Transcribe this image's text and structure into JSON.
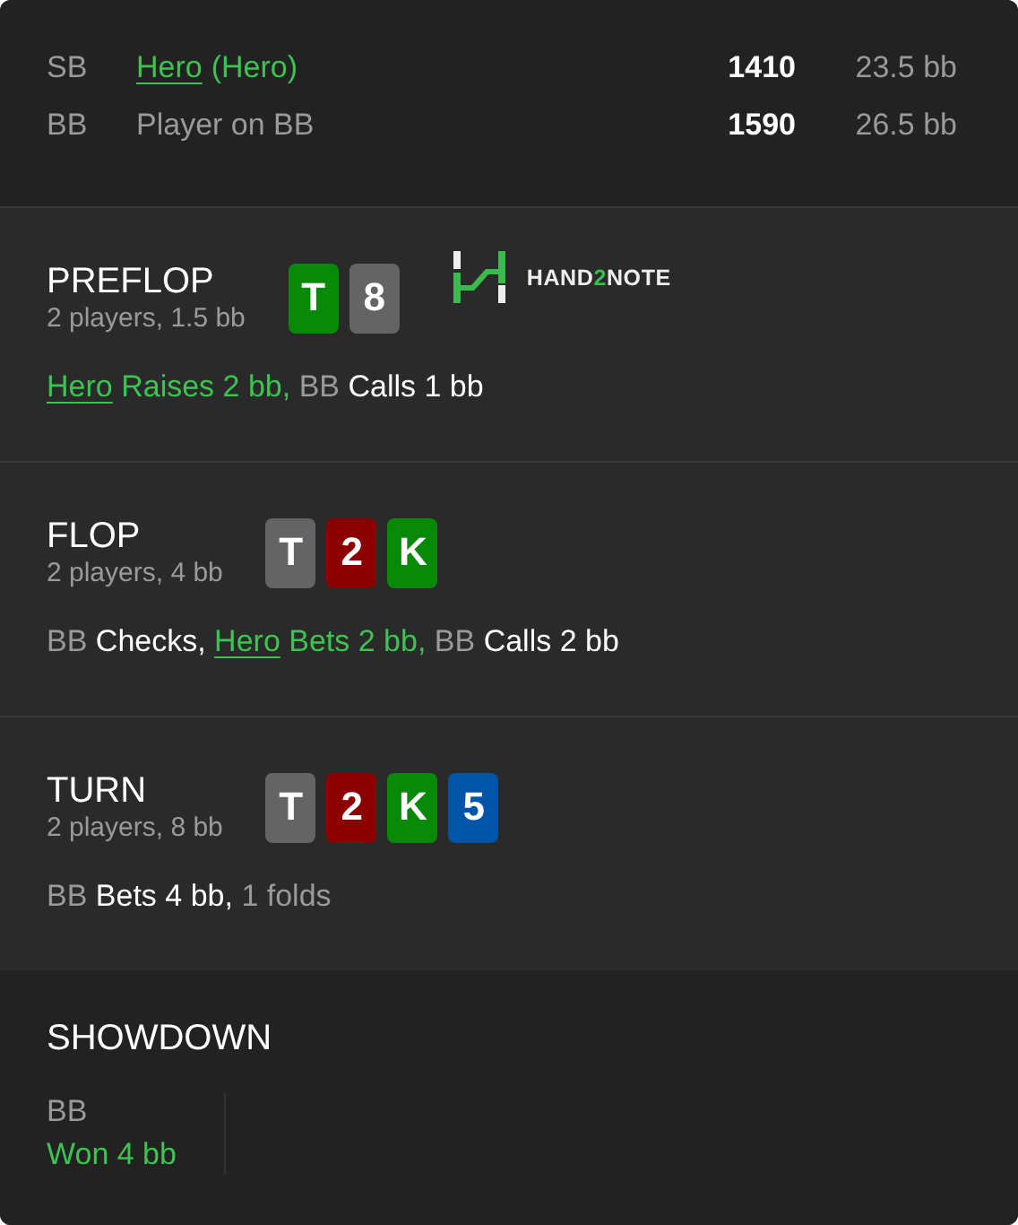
{
  "players": [
    {
      "position": "SB",
      "name": "Hero",
      "is_hero": true,
      "tag": "(Hero)",
      "stack": "1410",
      "stack_bb": "23.5 bb"
    },
    {
      "position": "BB",
      "name": "Player on BB",
      "is_hero": false,
      "stack": "1590",
      "stack_bb": "26.5 bb"
    }
  ],
  "streets": [
    {
      "title": "PREFLOP",
      "summary": "2 players, 1.5 bb",
      "cards": [
        {
          "rank": "T",
          "color": "#088a08"
        },
        {
          "rank": "8",
          "color": "#646464"
        }
      ],
      "logo": {
        "parts": [
          {
            "text": "HAND",
            "accent": false
          },
          {
            "text": "2",
            "accent": true
          },
          {
            "text": "NOTE",
            "accent": false
          }
        ]
      },
      "actions": [
        {
          "kind": "hero_link",
          "text": "Hero"
        },
        {
          "kind": "hero",
          "text": " Raises 2 bb,"
        },
        {
          "kind": "player",
          "text": " BB"
        },
        {
          "kind": "plain",
          "text": " Calls 1 bb"
        }
      ]
    },
    {
      "title": "FLOP",
      "summary": "2 players, 4 bb",
      "cards": [
        {
          "rank": "T",
          "color": "#646464"
        },
        {
          "rank": "2",
          "color": "#8c0000"
        },
        {
          "rank": "K",
          "color": "#088a08"
        }
      ],
      "actions": [
        {
          "kind": "player",
          "text": "BB"
        },
        {
          "kind": "plain",
          "text": " Checks, "
        },
        {
          "kind": "hero_link",
          "text": "Hero"
        },
        {
          "kind": "hero",
          "text": " Bets 2 bb,"
        },
        {
          "kind": "player",
          "text": " BB"
        },
        {
          "kind": "plain",
          "text": " Calls 2 bb"
        }
      ]
    },
    {
      "title": "TURN",
      "summary": "2 players, 8 bb",
      "cards": [
        {
          "rank": "T",
          "color": "#646464"
        },
        {
          "rank": "2",
          "color": "#8c0000"
        },
        {
          "rank": "K",
          "color": "#088a08"
        },
        {
          "rank": "5",
          "color": "#0055a8"
        }
      ],
      "actions": [
        {
          "kind": "player",
          "text": "BB"
        },
        {
          "kind": "plain",
          "text": " Bets 4 bb,"
        },
        {
          "kind": "player",
          "text": " 1 folds"
        }
      ]
    }
  ],
  "showdown": {
    "title": "SHOWDOWN",
    "results": [
      {
        "position": "BB",
        "result": "Won 4 bb"
      }
    ]
  }
}
